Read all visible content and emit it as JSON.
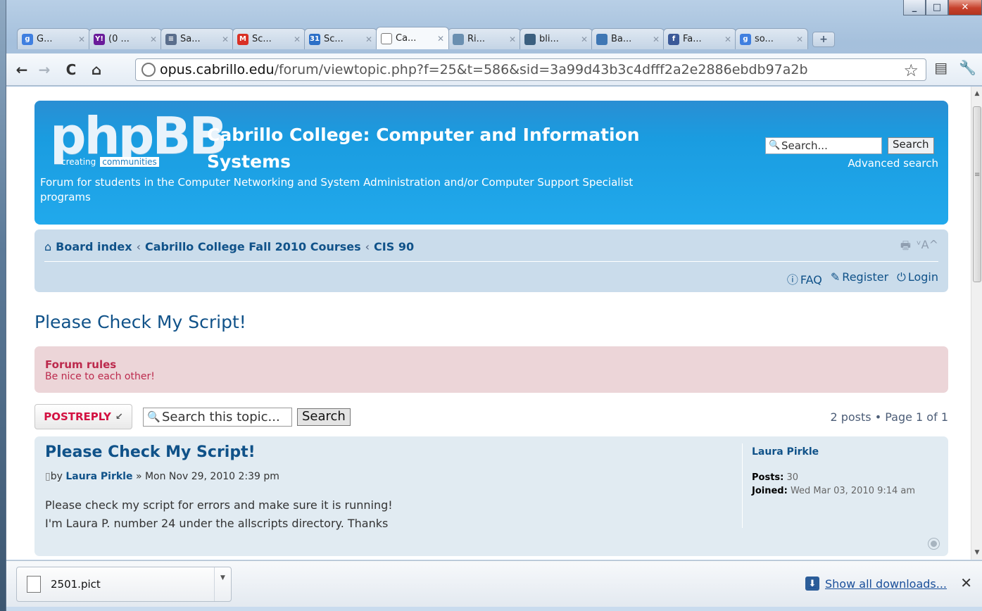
{
  "browser": {
    "tabs": [
      {
        "label": "G...",
        "icon": "google-icon",
        "color": "#3f7fe0",
        "glyph": "g"
      },
      {
        "label": "(0 ...",
        "icon": "yahoo-icon",
        "color": "#6a1b9a",
        "glyph": "Y!"
      },
      {
        "label": "Sa...",
        "icon": "calendar-icon",
        "color": "#5a6e8c",
        "glyph": "≡"
      },
      {
        "label": "Sc...",
        "icon": "gmail-icon",
        "color": "#d93025",
        "glyph": "M"
      },
      {
        "label": "Sc...",
        "icon": "calendar-31-icon",
        "color": "#2b6fc7",
        "glyph": "31"
      },
      {
        "label": "Ca...",
        "icon": "page-icon",
        "color": "#ffffff",
        "glyph": ""
      },
      {
        "label": "Ri...",
        "icon": "photo-icon",
        "color": "#6a8fb0",
        "glyph": ""
      },
      {
        "label": "bli...",
        "icon": "wifi-icon",
        "color": "#3b5f7f",
        "glyph": ""
      },
      {
        "label": "Ba...",
        "icon": "bird-icon",
        "color": "#3f77b4",
        "glyph": ""
      },
      {
        "label": "Fa...",
        "icon": "facebook-icon",
        "color": "#3b5998",
        "glyph": "f"
      },
      {
        "label": "so...",
        "icon": "google-icon",
        "color": "#3f7fe0",
        "glyph": "g"
      }
    ],
    "url_host": "opus.cabrillo.edu",
    "url_path": "/forum/viewtopic.php?f=25&t=586&sid=3a99d43b3c4dfff2a2e2886ebdb97a2b"
  },
  "header": {
    "logo_main": "phpBB",
    "logo_sub_left": "creating",
    "logo_sub_right": "communities",
    "site_title": "Cabrillo College: Computer and Information Systems",
    "site_description": "Forum for students in the Computer Networking and System Administration and/or Computer Support Specialist programs",
    "search_placeholder": "Search...",
    "search_button": "Search",
    "advanced_search": "Advanced search"
  },
  "navbar": {
    "breadcrumbs": [
      "Board index",
      "Cabrillo College Fall 2010 Courses",
      "CIS 90"
    ],
    "separator": "‹",
    "font_resize": "ᵛA^",
    "faq": "FAQ",
    "register": "Register",
    "login": "Login"
  },
  "topic": {
    "title": "Please Check My Script!",
    "rules_title": "Forum rules",
    "rules_text": "Be nice to each other!",
    "post_reply": "POSTREPLY",
    "search_placeholder": "Search this topic...",
    "search_button": "Search",
    "pagination": "2 posts • Page 1 of 1"
  },
  "post": {
    "title": "Please Check My Script!",
    "by": "by",
    "author": "Laura Pirkle",
    "date": "» Mon Nov 29, 2010 2:39 pm",
    "body_line1": "Please check my script for errors and make sure it is running!",
    "body_line2": "I'm Laura P. number 24 under the allscripts directory. Thanks",
    "profile": {
      "name": "Laura Pirkle",
      "posts_label": "Posts:",
      "posts_value": "30",
      "joined_label": "Joined:",
      "joined_value": "Wed Mar 03, 2010 9:14 am"
    }
  },
  "downloads": {
    "file_name": "2501.pict",
    "show_all": "Show all downloads..."
  }
}
